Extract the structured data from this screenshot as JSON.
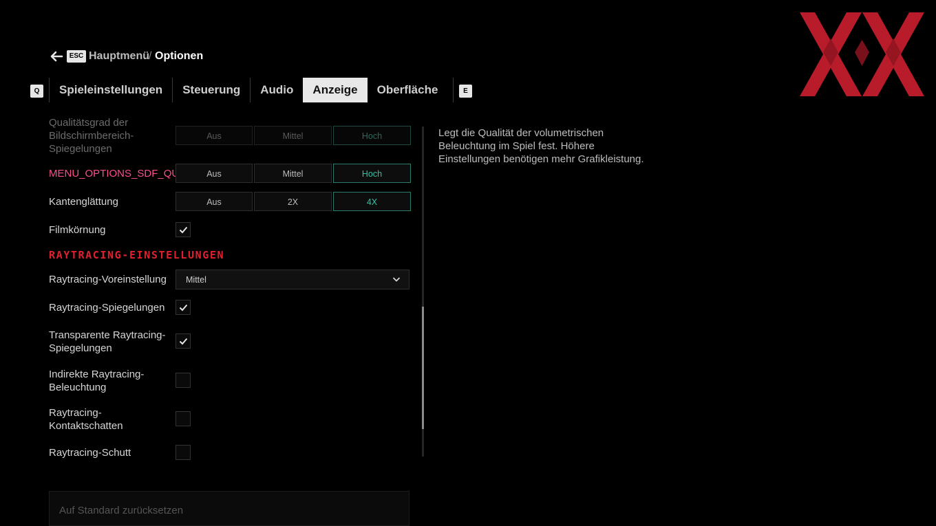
{
  "header": {
    "esc_key": "ESC",
    "crumb_prev": "Hauptmenü",
    "crumb_sep": "/",
    "crumb_current": "Optionen"
  },
  "tabs": {
    "prev_key": "Q",
    "next_key": "E",
    "items": [
      {
        "label": "Spieleinstellungen"
      },
      {
        "label": "Steuerung"
      },
      {
        "label": "Audio"
      },
      {
        "label": "Anzeige"
      },
      {
        "label": "Oberfläche"
      }
    ],
    "active_index": 3
  },
  "settings": {
    "ssr_quality": {
      "label": "Qualitätsgrad der Bildschirmbereich-Spiegelungen",
      "options": [
        "Aus",
        "Mittel",
        "Hoch"
      ],
      "selected": "Hoch"
    },
    "sdf_quality": {
      "label": "MENU_OPTIONS_SDF_QUALITY",
      "options": [
        "Aus",
        "Mittel",
        "Hoch"
      ],
      "selected": "Hoch"
    },
    "anti_aliasing": {
      "label": "Kantenglättung",
      "options": [
        "Aus",
        "2X",
        "4X"
      ],
      "selected": "4X"
    },
    "film_grain": {
      "label": "Filmkörnung",
      "checked": true
    }
  },
  "raytracing": {
    "section_title": "RAYTRACING-EINSTELLUNGEN",
    "preset": {
      "label": "Raytracing-Voreinstellung",
      "value": "Mittel"
    },
    "reflections": {
      "label": "Raytracing-Spiegelungen",
      "checked": true
    },
    "transparent_reflections": {
      "label": "Transparente Raytracing-Spiegelungen",
      "checked": true
    },
    "indirect_lighting": {
      "label": "Indirekte Raytracing-Beleuchtung",
      "checked": false
    },
    "contact_shadows": {
      "label": "Raytracing-Kontaktschatten",
      "checked": false
    },
    "debris": {
      "label": "Raytracing-Schutt",
      "checked": false
    }
  },
  "reset_button": "Auf Standard zurücksetzen",
  "description": "Legt die Qualität der volumetrischen Beleuchtung im Spiel fest. Höhere Einstellungen benötigen mehr Grafikleistung.",
  "colors": {
    "accent_red": "#e0202f",
    "selected_teal": "#2fc4a6",
    "highlight_pink": "#ff4d8d",
    "logo_red": "#b81c2a"
  }
}
